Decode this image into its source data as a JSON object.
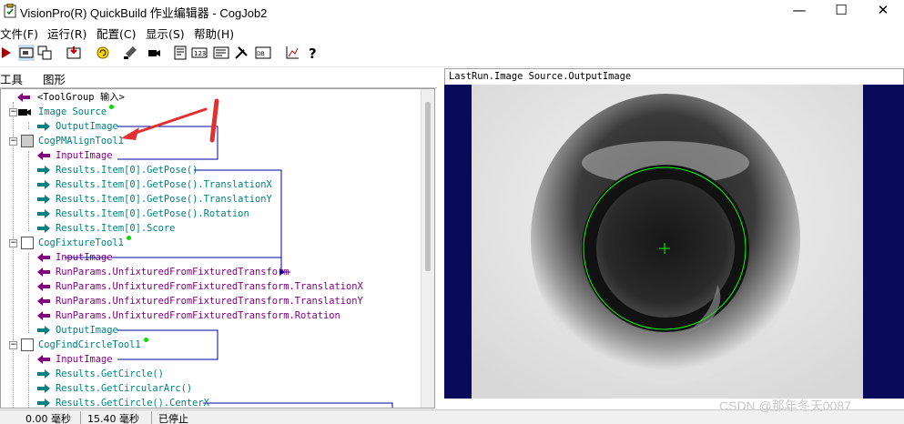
{
  "window": {
    "title": "VisionPro(R) QuickBuild 作业编辑器 - CogJob2",
    "minimize": "—",
    "maximize": "☐",
    "close": "✕"
  },
  "menu": [
    "文件(F)",
    "运行(R)",
    "配置(C)",
    "显示(S)",
    "帮助(H)"
  ],
  "toolbar_icons": [
    "run-icon",
    "image-icon",
    "copy-icon",
    "record-icon",
    "refresh-icon",
    "brush-icon",
    "camera-icon",
    "edit-icon",
    "numeric-icon",
    "terminal-icon",
    "tools-icon",
    "db-icon",
    "chart-icon",
    "help-icon"
  ],
  "left_tabs": [
    "工具",
    "图形"
  ],
  "tree": {
    "root": "<ToolGroup 输入>",
    "image_source": "Image Source",
    "output_image_1": "OutputImage",
    "pmalign": "CogPMAlignTool1",
    "pm_input": "InputImage",
    "pm_getpose": "Results.Item[0].GetPose()",
    "pm_tx": "Results.Item[0].GetPose().TranslationX",
    "pm_ty": "Results.Item[0].GetPose().TranslationY",
    "pm_rot": "Results.Item[0].GetPose().Rotation",
    "pm_score": "Results.Item[0].Score",
    "fixture": "CogFixtureTool1",
    "fx_input": "InputImage",
    "fx_transform": "RunParams.UnfixturedFromFixturedTransform",
    "fx_tx": "RunParams.UnfixturedFromFixturedTransform.TranslationX",
    "fx_ty": "RunParams.UnfixturedFromFixturedTransform.TranslationY",
    "fx_rot": "RunParams.UnfixturedFromFixturedTransform.Rotation",
    "fx_output": "OutputImage",
    "findcircle": "CogFindCircleTool1",
    "fc_input": "InputImage",
    "fc_getcircle": "Results.GetCircle()",
    "fc_arc": "Results.GetCircularArc()",
    "fc_centerx": "Results.GetCircle().CenterX"
  },
  "image_panel": {
    "header": "LastRun.Image Source.OutputImage"
  },
  "status": {
    "time1": "0.00 毫秒",
    "time2": "15.40 毫秒",
    "state": "已停止"
  },
  "watermark": "CSDN @那年冬天0087",
  "colors": {
    "input_arrow": "#800080",
    "output_arrow": "#008080",
    "link_line": "#0000a0",
    "annotation": "#e03030",
    "image_border": "#0a0a5a",
    "found_circle": "#00ff00"
  }
}
